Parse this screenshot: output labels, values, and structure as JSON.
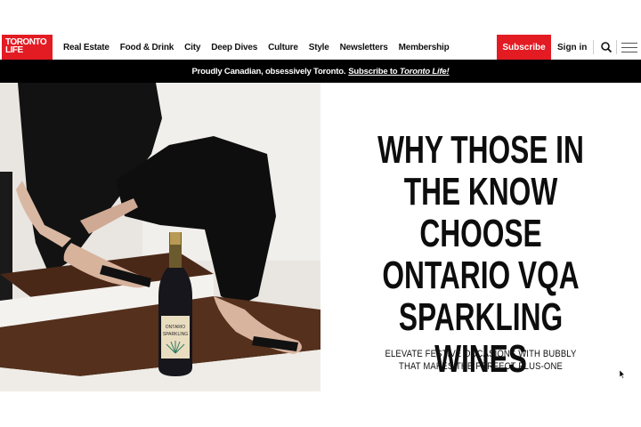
{
  "header": {
    "logo_line1": "TORONTO",
    "logo_line2": "LIFE",
    "nav": [
      "Real Estate",
      "Food & Drink",
      "City",
      "Deep Dives",
      "Culture",
      "Style",
      "Newsletters",
      "Membership"
    ],
    "subscribe_label": "Subscribe",
    "signin_label": "Sign in"
  },
  "banner": {
    "text": "Proudly Canadian, obsessively Toronto.",
    "link_prefix": "Subscribe to",
    "link_brand": "Toronto Life!"
  },
  "hero": {
    "headline": "WHY THOSE IN THE KNOW CHOOSE ONTARIO VQA SPARKLING WINES",
    "subheadline": "ELEVATE FESTIVE OCCASIONS WITH BUBBLY THAT MAKES THE PERFECT PLUS-ONE",
    "bottle_label_line1": "ONTARIO",
    "bottle_label_line2": "SPARKLING"
  },
  "colors": {
    "brand_red": "#e31b23",
    "banner_bg": "#000000"
  }
}
